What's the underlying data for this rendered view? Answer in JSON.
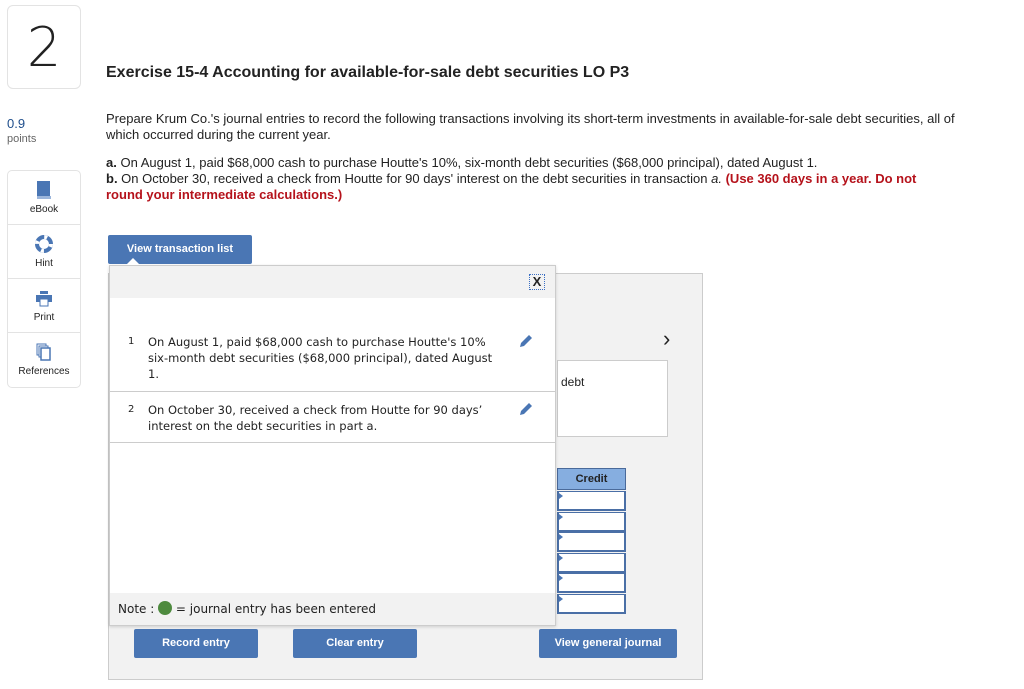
{
  "question": {
    "number": "2",
    "points": "0.9",
    "points_label": "points"
  },
  "tools": [
    {
      "label": "eBook",
      "icon": "book-icon"
    },
    {
      "label": "Hint",
      "icon": "lifebuoy-icon"
    },
    {
      "label": "Print",
      "icon": "printer-icon"
    },
    {
      "label": "References",
      "icon": "copy-icon"
    }
  ],
  "exercise": {
    "title": "Exercise 15-4 Accounting for available-for-sale debt securities LO P3",
    "intro": "Prepare Krum Co.'s journal entries to record the following transactions involving its short-term investments in available-for-sale debt securities, all of which occurred during the current year.",
    "a_label": "a.",
    "a_text": " On August 1, paid $68,000 cash to purchase Houtte's 10%, six-month debt securities ($68,000 principal), dated August 1.",
    "b_label": "b.",
    "b_text": " On October 30, received a check from Houtte for 90 days' interest on the debt securities in transaction ",
    "b_italic": "a.",
    "b_red": " (Use 360 days in a year. Do not round your intermediate calculations.)"
  },
  "buttons": {
    "view_transactions": "View transaction list",
    "record": "Record entry",
    "clear": "Clear entry",
    "view_journal": "View general journal"
  },
  "journal": {
    "partial_text": "debt",
    "credit_header": "Credit",
    "next": "›"
  },
  "popup": {
    "close": "X",
    "transactions": [
      {
        "num": "1",
        "text": "On August 1, paid $68,000 cash to purchase Houtte's 10% six-month debt securities ($68,000 principal), dated August 1."
      },
      {
        "num": "2",
        "text": "On October 30, received a check from Houtte for 90 days’ interest on the debt securities in part a."
      }
    ],
    "note_prefix": "Note : ",
    "note_suffix": " = journal entry has been entered"
  },
  "colors": {
    "accent": "#4a76b4",
    "entered": "#4e8a3e",
    "warning": "#b5121b"
  }
}
